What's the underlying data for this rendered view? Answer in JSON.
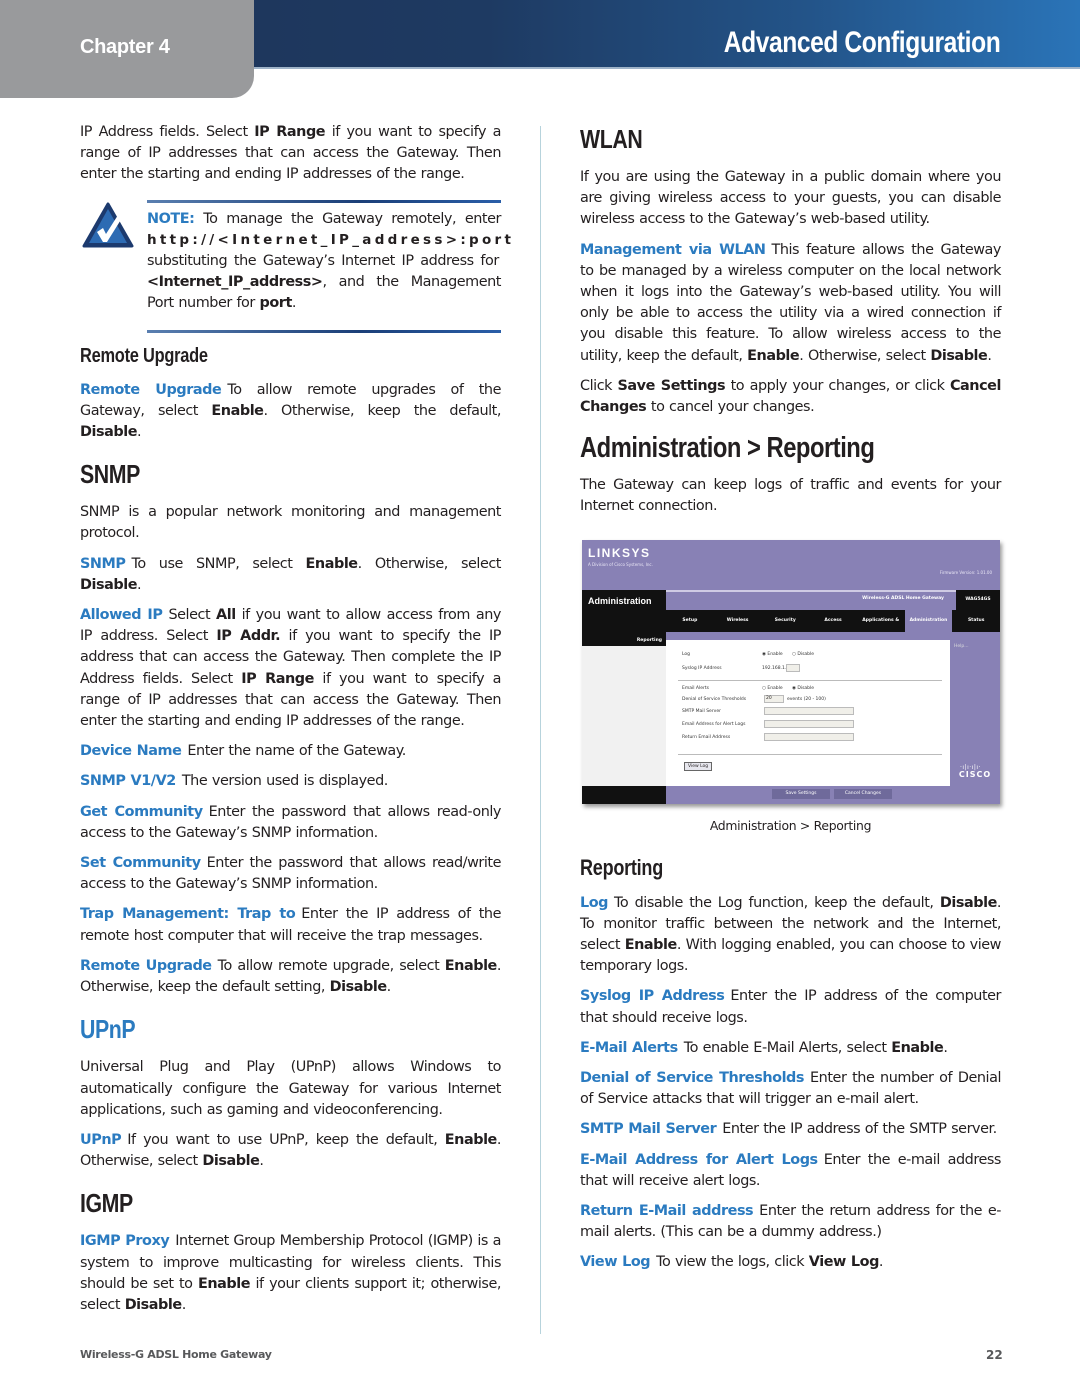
{
  "header": {
    "chapter": "Chapter 4",
    "title": "Advanced Configuration"
  },
  "left": {
    "intro": {
      "t1": "IP Address fields. Select ",
      "b1": "IP Range",
      "t2": " if you want to specify a range of IP addresses that can access the Gateway. Then enter the starting and ending IP addresses of the range."
    },
    "note": {
      "label": "NOTE:",
      "t1": " To manage the Gateway remotely, enter ",
      "url": "http://<Internet_IP_address>:port",
      "t2": " substituting the Gateway’s Internet IP address for ",
      "b1": "<Internet_IP_address>",
      "t3": ", and the Management Port number for ",
      "b2": "port",
      "t4": "."
    },
    "remote_upgrade_heading": "Remote Upgrade",
    "remote_upgrade": {
      "term": "Remote Upgrade",
      "t1": "To allow remote upgrades of the Gateway, select ",
      "b1": "Enable",
      "t2": ". Otherwise, keep the default, ",
      "b2": "Disable",
      "t3": "."
    },
    "snmp_heading": "SNMP",
    "snmp_intro": "SNMP is a popular network monitoring and management protocol.",
    "snmp": {
      "term": "SNMP",
      "t1": "To use SNMP, select ",
      "b1": "Enable",
      "t2": ". Otherwise, select ",
      "b2": "Disable",
      "t3": "."
    },
    "allowed_ip": {
      "term": "Allowed IP",
      "t1": "Select ",
      "b1": "All",
      "t2": " if you want to allow access from any IP address. Select ",
      "b2": "IP Addr.",
      "t3": " if you want to specify the IP address that can access the Gateway. Then complete the IP Address fields. Select ",
      "b3": "IP Range",
      "t4": " if you want to specify a range of IP addresses that can access the Gateway. Then enter the starting and ending IP addresses of the range."
    },
    "device_name": {
      "term": "Device Name",
      "t1": "Enter the name of the Gateway."
    },
    "snmp_version": {
      "term": "SNMP V1/V2",
      "t1": "The version used is displayed."
    },
    "get_community": {
      "term": "Get Community",
      "t1": "Enter the password that allows read-only access to the Gateway’s SNMP information."
    },
    "set_community": {
      "term": "Set Community",
      "t1": "Enter the password that allows read/write access to the Gateway’s SNMP information."
    },
    "trap": {
      "term": "Trap Management: Trap to",
      "t1": "Enter the IP address of the remote host computer that will receive the trap messages."
    },
    "remote_upgrade2": {
      "term": "Remote Upgrade",
      "t1": "To allow remote upgrade, select ",
      "b1": "Enable",
      "t2": ". Otherwise, keep the default setting, ",
      "b2": "Disable",
      "t3": "."
    },
    "upnp_heading": "UPnP",
    "upnp_intro": "Universal Plug and Play (UPnP) allows Windows to automatically configure the Gateway for various Internet applications, such as gaming and videoconferencing.",
    "upnp": {
      "term": "UPnP",
      "t1": "If you want to use UPnP, keep the default, ",
      "b1": "Enable",
      "t2": ". Otherwise, select ",
      "b2": "Disable",
      "t3": "."
    },
    "igmp_heading": "IGMP",
    "igmp": {
      "term": "IGMP Proxy",
      "t1": "Internet Group Membership Protocol (IGMP) is a system to improve multicasting for wireless clients. This should be set to ",
      "b1": "Enable",
      "t2": " if your clients support it; otherwise, select ",
      "b2": "Disable",
      "t3": "."
    }
  },
  "right": {
    "wlan_heading": "WLAN",
    "wlan_intro": "If you are using the Gateway in a public domain where you are giving wireless access to your guests, you can disable wireless access to the Gateway’s web-based utility.",
    "mgmt_wlan": {
      "term": "Management via WLAN",
      "t1": "This feature allows the Gateway to be managed by a wireless computer on the local network when it logs into the Gateway’s web-based utility. You will only be able to access the utility via a wired connection if you disable this feature. To allow wireless access to the utility, keep the default, ",
      "b1": "Enable",
      "t2": ". Otherwise, select ",
      "b2": "Disable",
      "t3": "."
    },
    "save_note": {
      "t1": "Click ",
      "b1": "Save Settings",
      "t2": " to apply your changes, or click ",
      "b2": "Cancel Changes",
      "t3": " to cancel your changes."
    },
    "admin_heading": "Administration > Reporting",
    "admin_intro": "The Gateway can keep logs of traffic and events for your Internet connection.",
    "screenshot": {
      "logo": "LINKSYS",
      "logo_sub": "A Division of Cisco Systems, Inc.",
      "firmware": "Firmware Version: 1.01.00",
      "section": "Administration",
      "product": "Wireless-G ADSL Home Gateway",
      "model": "WAG54GS",
      "nav": [
        "Setup",
        "Wireless",
        "Security",
        "Access Restrictions",
        "Applications & Gaming",
        "Administration",
        "Status"
      ],
      "sidebar_label": "Reporting",
      "fields": {
        "log": "Log",
        "syslog": "Syslog IP Address",
        "syslog_value": "192.168.1.",
        "email_alerts": "Email Alerts",
        "dos": "Denial of Service Thresholds",
        "dos_value": "20",
        "dos_unit": "events (20 - 100)",
        "smtp": "SMTP Mail Server",
        "email_addr": "Email Address for Alert Logs",
        "return_email": "Return Email Address",
        "enable": "Enable",
        "disable": "Disable"
      },
      "view_log_button": "View Log",
      "save_button": "Save Settings",
      "cancel_button": "Cancel Changes",
      "help": "Help...",
      "brand": "CISCO"
    },
    "caption": "Administration > Reporting",
    "reporting_heading": "Reporting",
    "log": {
      "term": "Log",
      "t1": "To disable the Log function, keep the default, ",
      "b1": "Disable",
      "t2": ". To monitor traffic between the network and the Internet, select ",
      "b2": "Enable",
      "t3": ". With logging enabled, you can choose to view temporary logs."
    },
    "syslog": {
      "term": "Syslog IP Address",
      "t1": "Enter the IP address of the computer that should receive logs."
    },
    "email_alerts": {
      "term": "E-Mail Alerts",
      "t1": "To enable E-Mail Alerts, select ",
      "b1": "Enable",
      "t2": "."
    },
    "dos": {
      "term": "Denial of Service Thresholds",
      "t1": "Enter the number of Denial of Service attacks that will trigger an e-mail alert."
    },
    "smtp": {
      "term": "SMTP Mail Server",
      "t1": "Enter the IP address of the SMTP server."
    },
    "email_addr": {
      "term": "E-Mail Address for Alert Logs",
      "t1": "Enter the e-mail address that will receive alert logs."
    },
    "return_email": {
      "term": "Return E-Mail address",
      "t1": "Enter the return address for the e-mail alerts. (This can be a dummy address.)"
    },
    "view_log": {
      "term": "View Log",
      "t1": "To view the logs, click ",
      "b1": "View Log",
      "t2": "."
    }
  },
  "footer": {
    "product": "Wireless-G ADSL Home Gateway",
    "page": "22"
  }
}
